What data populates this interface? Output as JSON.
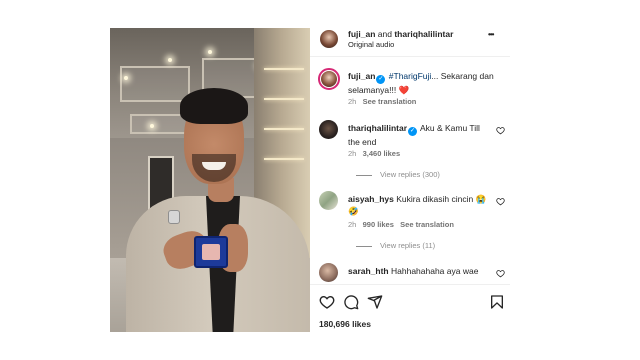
{
  "header": {
    "author1": "fuji_an",
    "and": "and",
    "author2": "thariqhalilintar",
    "subtitle": "Original audio",
    "more": "•••"
  },
  "caption": {
    "username": "fuji_an",
    "hashtag": "#TharigFuji",
    "text1": "... Sekarang dan",
    "text2": "selamanya!!!",
    "emoji": "❤️",
    "time": "2h",
    "see_translation": "See translation"
  },
  "comments": [
    {
      "username": "thariqhalilintar",
      "verified": true,
      "text1": "Aku & Kamu Till",
      "text2": "the end",
      "time": "2h",
      "likes": "3,460 likes",
      "view_replies": "View replies (300)"
    },
    {
      "username": "aisyah_hys",
      "text1": "Kukira dikasih cincin",
      "emoji1": "😭",
      "emoji2": "🤣",
      "time": "2h",
      "likes": "990 likes",
      "see_translation": "See translation",
      "view_replies": "View replies (11)"
    },
    {
      "username": "sarah_hth",
      "text1": "Hahhahahaha aya wae"
    }
  ],
  "actions": {
    "like_icon": "heart-icon",
    "comment_icon": "comment-icon",
    "share_icon": "send-icon",
    "save_icon": "bookmark-icon"
  },
  "likes_total": "180,696 likes",
  "colors": {
    "verified": "#0095f6",
    "hashtag": "#00376b",
    "heart": "#ed4956",
    "meta": "#8e8e8e"
  }
}
